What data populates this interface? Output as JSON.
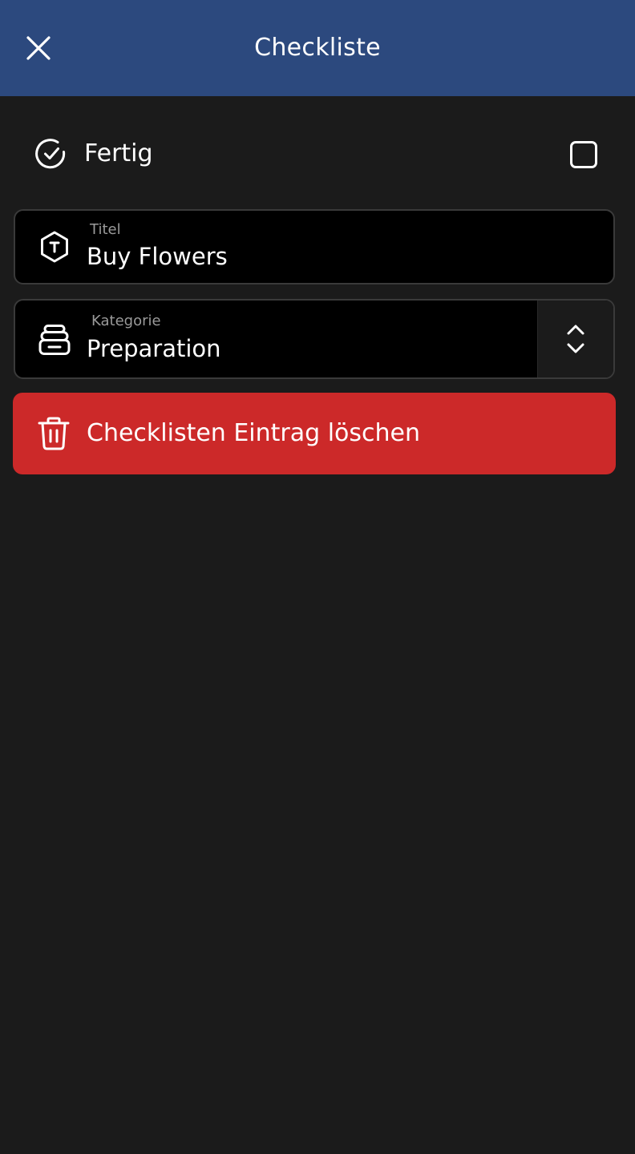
{
  "header": {
    "title": "Checkliste",
    "background": "#2c497e"
  },
  "done": {
    "label": "Fertig",
    "checked": false
  },
  "title_field": {
    "label": "Titel",
    "value": "Buy Flowers"
  },
  "category_field": {
    "label": "Kategorie",
    "value": "Preparation"
  },
  "delete_button": {
    "label": "Checklisten Eintrag löschen",
    "color": "#cc2929"
  },
  "icons": {
    "close": "close-icon",
    "done": "check-circle-icon",
    "title": "text-hexagon-icon",
    "category": "stack-tray-icon",
    "select": "chevron-up-down-icon",
    "delete": "trash-icon"
  }
}
